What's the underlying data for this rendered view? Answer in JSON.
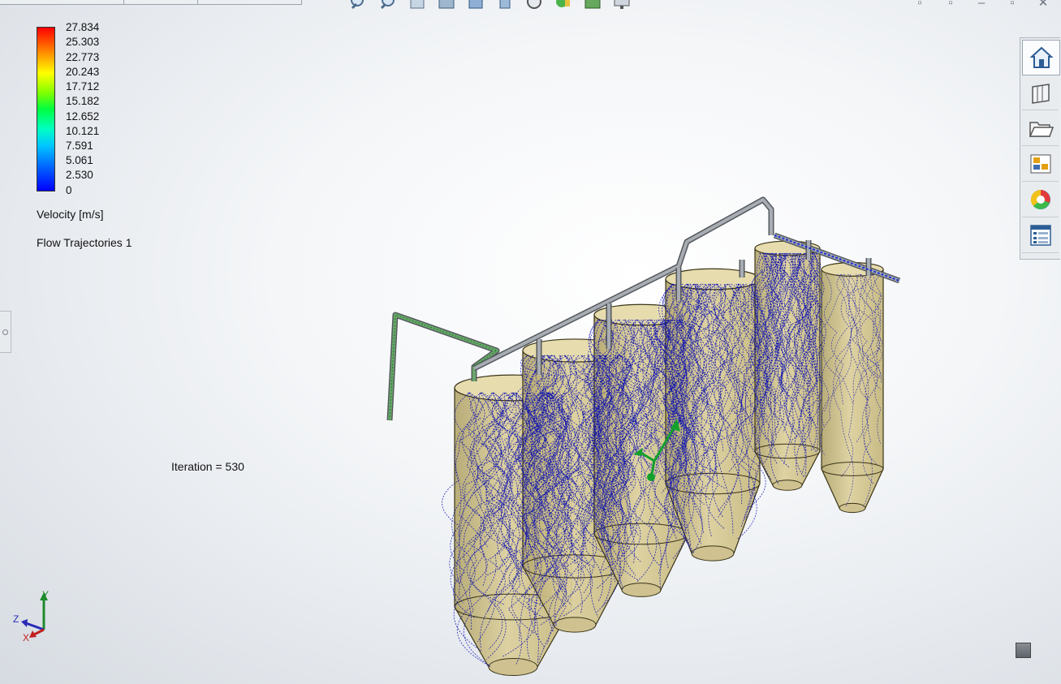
{
  "legend": {
    "ticks": [
      "27.834",
      "25.303",
      "22.773",
      "20.243",
      "17.712",
      "15.182",
      "12.652",
      "10.121",
      "7.591",
      "5.061",
      "2.530",
      "0"
    ],
    "title": "Velocity [m/s]",
    "plot_name": "Flow Trajectories 1"
  },
  "iteration_label": "Iteration = 530",
  "triad": {
    "y": "Y",
    "z": "Z",
    "x": "X"
  },
  "taskpane": [
    "home-icon",
    "library-icon",
    "file-explorer-icon",
    "view-palette-icon",
    "appearances-icon",
    "custom-properties-icon"
  ],
  "colors": {
    "trajectory": "#0a0fb0",
    "tank_fill": "#d8cc96",
    "tank_edge": "#3a3418",
    "pipe": "#a8adb3"
  },
  "window_controls": [
    "▫",
    "▫",
    "–",
    "▫",
    "✕"
  ]
}
